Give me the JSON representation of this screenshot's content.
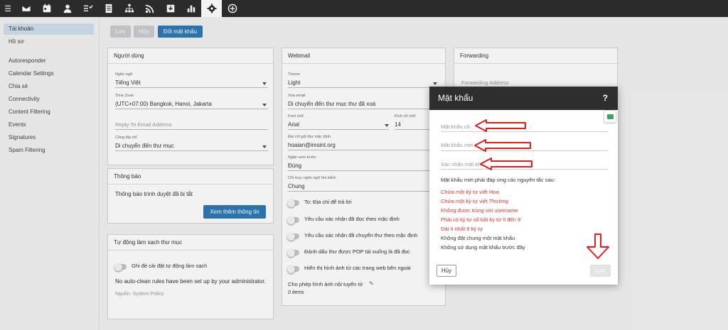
{
  "sidebar": {
    "items": [
      "Tài khoản",
      "Hồ sơ",
      "Autoresponder",
      "Calendar Settings",
      "Chia sẻ",
      "Connectivity",
      "Content Filtering",
      "Events",
      "Signatures",
      "Spam Filtering"
    ]
  },
  "toolbar": {
    "save": "Lưu",
    "cancel": "Hủy",
    "change_password": "Đổi mật khẩu"
  },
  "nguoidung": {
    "title": "Người dùng",
    "lang_label": "Ngôn ngữ",
    "lang_value": "Tiếng Việt",
    "tz_label": "Time Zone",
    "tz_value": "(UTC+07:00) Bangkok, Hanoi, Jakarta",
    "reply_placeholder": "Reply-To Email Address",
    "addr_label": "Công địa chỉ",
    "addr_value": "Di chuyển đến thư mục"
  },
  "thongbao": {
    "title": "Thông báo",
    "text": "Thông báo trình duyệt đã bị tắt",
    "button": "Xem thêm thông tin"
  },
  "autoclean": {
    "title": "Tự động làm sạch thư mục",
    "toggle_label": "Ghi đè cài đặt tự động làm sạch",
    "note": "No auto-clean rules have been set up by your administrator.",
    "policy": "Nguồn: System Policy"
  },
  "webmail": {
    "title": "Webmail",
    "theme_label": "Theme",
    "theme_value": "Light",
    "delete_label": "Xóa email",
    "delete_value": "Di chuyển đến thư mục thư đã xoá",
    "font_label": "Font chữ",
    "font_value": "Arial",
    "size_label": "Kích cỡ chữ",
    "size_value": "14",
    "sender_label": "Địa chỉ gửi thư mặc định",
    "sender_value": "hoaian@imsint.org",
    "preview_label": "Ngăn xem trước",
    "preview_value": "Đúng",
    "lang_label": "Chỉ mục ngôn ngữ tìm kiếm",
    "lang_value": "Chung",
    "toggles": [
      "To: Địa chỉ để trả lời",
      "Yêu cầu xác nhận đã đọc theo mặc định",
      "Yêu cầu xác nhận đã chuyển thư theo mặc định",
      "Đánh dấu thư được POP tải xuống là đã đọc",
      "Hiển thị hình ảnh từ các trang web bên ngoài"
    ],
    "images_label": "Cho phép hình ảnh nội tuyến từ",
    "images_count": "0 items"
  },
  "forwarding": {
    "title": "Forwarding",
    "placeholder": "Forwarding Address"
  },
  "modal": {
    "title": "Mật khẩu",
    "help": "?",
    "old_placeholder": "Mật khẩu cũ",
    "new_placeholder": "Mật khẩu mới *",
    "confirm_placeholder": "Xác nhận mật khẩu",
    "rules_intro": "Mật khẩu mới phải đáp ứng các nguyên tắc sau:",
    "rules_failed": [
      "Chứa một ký tự viết Hoa",
      "Chứa một ký tự viết Thường",
      "Không được trùng với username",
      "Phải có ký tự số bất kỳ từ 0 đến 9",
      "Dài ít nhất 8 ký tự"
    ],
    "rules_ok": [
      "Không đặt chung một mật khẩu",
      "Không sử dụng mật khẩu trước đây"
    ],
    "cancel": "Hủy",
    "save": "Lưu"
  },
  "colors": {
    "topbar": "#2e2e2e",
    "primary": "#2f7ab8",
    "error": "#d9342b",
    "annotation": "#e0201c"
  }
}
